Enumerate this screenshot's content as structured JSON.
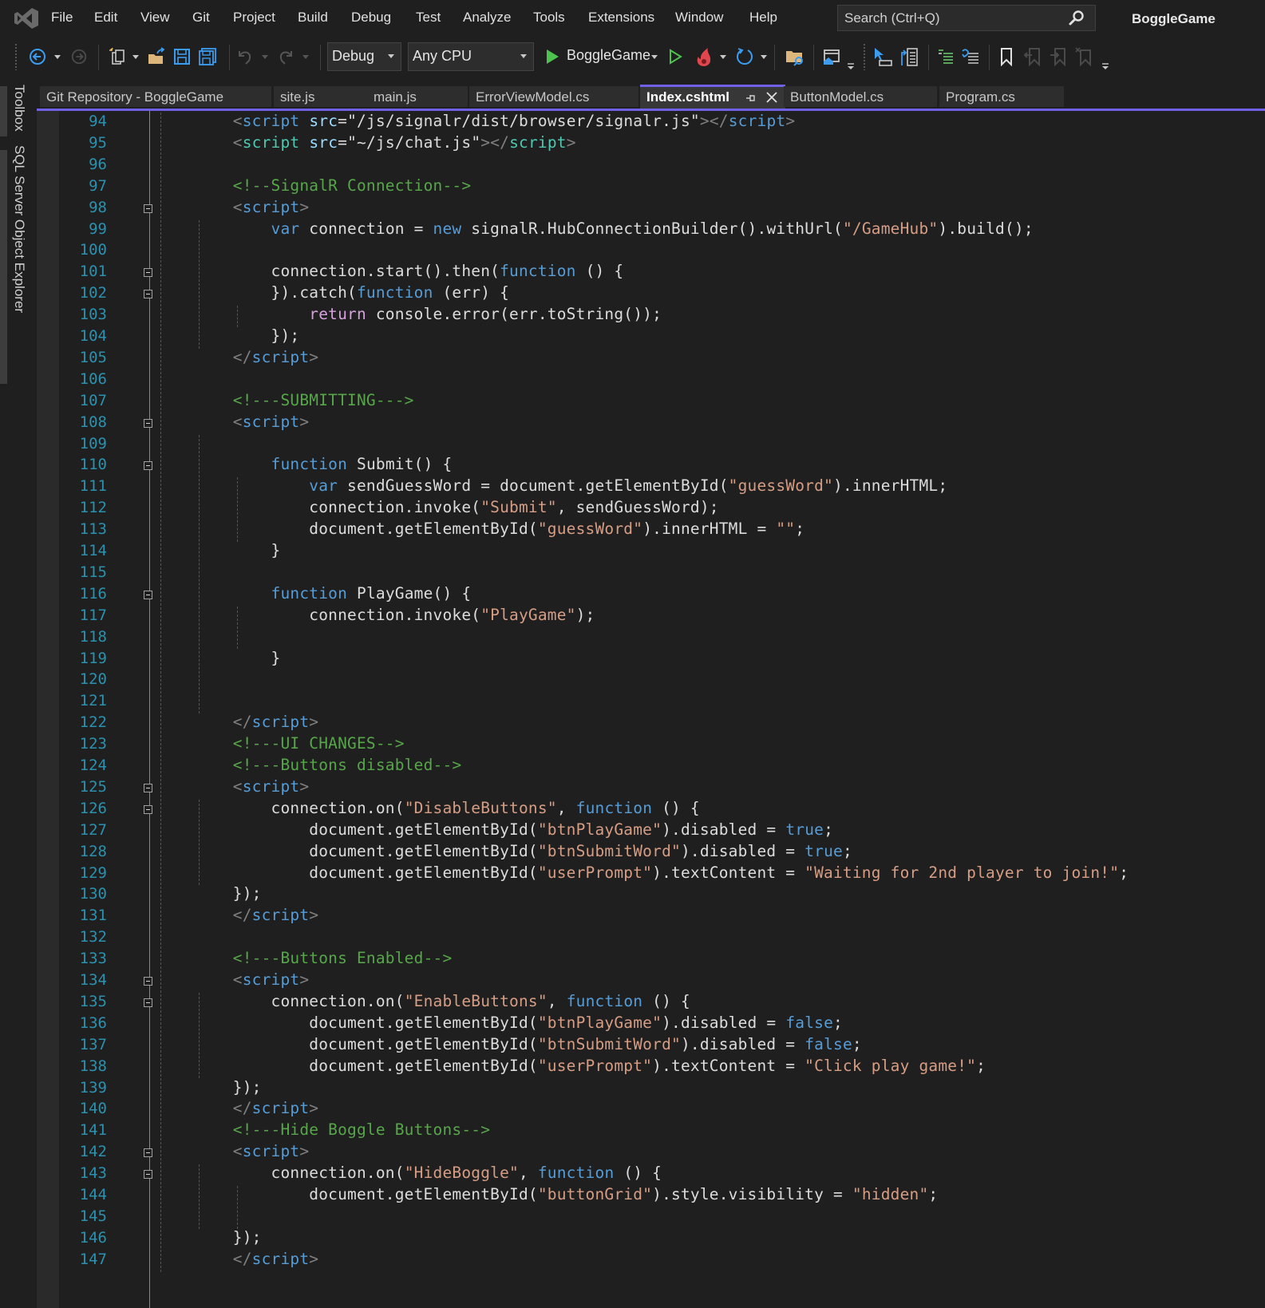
{
  "app": {
    "solution_name": "BoggleGame",
    "accent_color": "#7160e8"
  },
  "menu": {
    "items": [
      "File",
      "Edit",
      "View",
      "Git",
      "Project",
      "Build",
      "Debug",
      "Test",
      "Analyze",
      "Tools",
      "Extensions",
      "Window",
      "Help"
    ],
    "search_placeholder": "Search (Ctrl+Q)"
  },
  "toolbar": {
    "configuration": "Debug",
    "platform": "Any CPU",
    "start_target": "BoggleGame",
    "icons": [
      "back-icon",
      "forward-icon",
      "new-project-icon",
      "open-folder-icon",
      "save-icon",
      "save-all-icon",
      "undo-icon",
      "redo-icon",
      "start-icon",
      "start-without-debugging-icon",
      "hot-reload-icon",
      "restart-icon",
      "solution-explorer-icon",
      "browser-link-icon",
      "select-element-icon",
      "toggle-view-icon",
      "indent-icon",
      "outdent-icon",
      "bookmark-icon",
      "prev-bookmark-icon",
      "next-bookmark-icon",
      "clear-bookmarks-icon",
      "toolbar-options-icon"
    ]
  },
  "side_panels": [
    "Toolbox",
    "SQL Server Object Explorer"
  ],
  "tabs": [
    {
      "label": "Git Repository - BoggleGame",
      "active": false
    },
    {
      "label": "site.js",
      "active": false
    },
    {
      "label": "main.js",
      "active": false
    },
    {
      "label": "ErrorViewModel.cs",
      "active": false
    },
    {
      "label": "Index.cshtml",
      "active": true
    },
    {
      "label": "ButtonModel.cs",
      "active": false
    },
    {
      "label": "Program.cs",
      "active": false
    }
  ],
  "editor": {
    "first_line": 94,
    "lines": [
      {
        "n": "94",
        "fold": false,
        "tokens": [
          [
            "    ",
            "id"
          ],
          [
            "<",
            "pun"
          ],
          [
            "script",
            "tag"
          ],
          [
            " ",
            "id"
          ],
          [
            "src",
            "attr"
          ],
          [
            "=",
            "id"
          ],
          [
            "\"/js/signalr/dist/browser/signalr.js\"",
            "id"
          ],
          [
            "></",
            "pun"
          ],
          [
            "script",
            "tag"
          ],
          [
            ">",
            "pun"
          ]
        ]
      },
      {
        "n": "95",
        "fold": false,
        "tokens": [
          [
            "    ",
            "id"
          ],
          [
            "<",
            "pun"
          ],
          [
            "script",
            "tag2"
          ],
          [
            " ",
            "id"
          ],
          [
            "src",
            "attr"
          ],
          [
            "=",
            "id"
          ],
          [
            "\"~/js/chat.js\"",
            "id"
          ],
          [
            "></",
            "pun"
          ],
          [
            "script",
            "tag2"
          ],
          [
            ">",
            "pun"
          ]
        ]
      },
      {
        "n": "96",
        "fold": false,
        "tokens": []
      },
      {
        "n": "97",
        "fold": false,
        "tokens": [
          [
            "    ",
            "id"
          ],
          [
            "<!--SignalR Connection-->",
            "cmt"
          ]
        ]
      },
      {
        "n": "98",
        "fold": true,
        "tokens": [
          [
            "    ",
            "id"
          ],
          [
            "<",
            "pun"
          ],
          [
            "script",
            "tag"
          ],
          [
            ">",
            "pun"
          ]
        ]
      },
      {
        "n": "99",
        "fold": false,
        "tokens": [
          [
            "        ",
            "id"
          ],
          [
            "var",
            "kw"
          ],
          [
            " connection = ",
            "id"
          ],
          [
            "new",
            "kw"
          ],
          [
            " signalR.HubConnectionBuilder().withUrl(",
            "id"
          ],
          [
            "\"/GameHub\"",
            "str"
          ],
          [
            ").build();",
            "id"
          ]
        ]
      },
      {
        "n": "100",
        "fold": false,
        "tokens": []
      },
      {
        "n": "101",
        "fold": true,
        "tokens": [
          [
            "        connection.start().then(",
            "id"
          ],
          [
            "function",
            "kw"
          ],
          [
            " () {",
            "id"
          ]
        ]
      },
      {
        "n": "102",
        "fold": true,
        "tokens": [
          [
            "        }).catch(",
            "id"
          ],
          [
            "function",
            "kw"
          ],
          [
            " (err) {",
            "id"
          ]
        ]
      },
      {
        "n": "103",
        "fold": false,
        "tokens": [
          [
            "            ",
            "id"
          ],
          [
            "return",
            "ctl"
          ],
          [
            " console.error(err.toString());",
            "id"
          ]
        ]
      },
      {
        "n": "104",
        "fold": false,
        "tokens": [
          [
            "        });",
            "id"
          ]
        ]
      },
      {
        "n": "105",
        "fold": false,
        "tokens": [
          [
            "    ",
            "id"
          ],
          [
            "</",
            "pun"
          ],
          [
            "script",
            "tag"
          ],
          [
            ">",
            "pun"
          ]
        ]
      },
      {
        "n": "106",
        "fold": false,
        "tokens": []
      },
      {
        "n": "107",
        "fold": false,
        "tokens": [
          [
            "    ",
            "id"
          ],
          [
            "<!---SUBMITTING--->",
            "cmt"
          ]
        ]
      },
      {
        "n": "108",
        "fold": true,
        "tokens": [
          [
            "    ",
            "id"
          ],
          [
            "<",
            "pun"
          ],
          [
            "script",
            "tag"
          ],
          [
            ">",
            "pun"
          ]
        ]
      },
      {
        "n": "109",
        "fold": false,
        "tokens": []
      },
      {
        "n": "110",
        "fold": true,
        "tokens": [
          [
            "        ",
            "id"
          ],
          [
            "function",
            "kw"
          ],
          [
            " Submit() {",
            "id"
          ]
        ]
      },
      {
        "n": "111",
        "fold": false,
        "tokens": [
          [
            "            ",
            "id"
          ],
          [
            "var",
            "kw"
          ],
          [
            " sendGuessWord = document.getElementById(",
            "id"
          ],
          [
            "\"guessWord\"",
            "str"
          ],
          [
            ").innerHTML;",
            "id"
          ]
        ]
      },
      {
        "n": "112",
        "fold": false,
        "tokens": [
          [
            "            connection.invoke(",
            "id"
          ],
          [
            "\"Submit\"",
            "str"
          ],
          [
            ", sendGuessWord);",
            "id"
          ]
        ]
      },
      {
        "n": "113",
        "fold": false,
        "tokens": [
          [
            "            document.getElementById(",
            "id"
          ],
          [
            "\"guessWord\"",
            "str"
          ],
          [
            ").innerHTML = ",
            "id"
          ],
          [
            "\"\"",
            "str"
          ],
          [
            ";",
            "id"
          ]
        ]
      },
      {
        "n": "114",
        "fold": false,
        "tokens": [
          [
            "        }",
            "id"
          ]
        ]
      },
      {
        "n": "115",
        "fold": false,
        "tokens": []
      },
      {
        "n": "116",
        "fold": true,
        "tokens": [
          [
            "        ",
            "id"
          ],
          [
            "function",
            "kw"
          ],
          [
            " PlayGame() {",
            "id"
          ]
        ]
      },
      {
        "n": "117",
        "fold": false,
        "tokens": [
          [
            "            connection.invoke(",
            "id"
          ],
          [
            "\"PlayGame\"",
            "str"
          ],
          [
            ");",
            "id"
          ]
        ]
      },
      {
        "n": "118",
        "fold": false,
        "tokens": []
      },
      {
        "n": "119",
        "fold": false,
        "tokens": [
          [
            "        }",
            "id"
          ]
        ]
      },
      {
        "n": "120",
        "fold": false,
        "tokens": []
      },
      {
        "n": "121",
        "fold": false,
        "tokens": []
      },
      {
        "n": "122",
        "fold": false,
        "tokens": [
          [
            "    ",
            "id"
          ],
          [
            "</",
            "pun"
          ],
          [
            "script",
            "tag"
          ],
          [
            ">",
            "pun"
          ]
        ]
      },
      {
        "n": "123",
        "fold": false,
        "tokens": [
          [
            "    ",
            "id"
          ],
          [
            "<!---UI CHANGES-->",
            "cmt"
          ]
        ]
      },
      {
        "n": "124",
        "fold": false,
        "tokens": [
          [
            "    ",
            "id"
          ],
          [
            "<!---Buttons disabled-->",
            "cmt"
          ]
        ]
      },
      {
        "n": "125",
        "fold": true,
        "tokens": [
          [
            "    ",
            "id"
          ],
          [
            "<",
            "pun"
          ],
          [
            "script",
            "tag"
          ],
          [
            ">",
            "pun"
          ]
        ]
      },
      {
        "n": "126",
        "fold": true,
        "tokens": [
          [
            "        connection.on(",
            "id"
          ],
          [
            "\"DisableButtons\"",
            "str"
          ],
          [
            ", ",
            "id"
          ],
          [
            "function",
            "kw"
          ],
          [
            " () {",
            "id"
          ]
        ]
      },
      {
        "n": "127",
        "fold": false,
        "tokens": [
          [
            "            document.getElementById(",
            "id"
          ],
          [
            "\"btnPlayGame\"",
            "str"
          ],
          [
            ").disabled = ",
            "id"
          ],
          [
            "true",
            "kw"
          ],
          [
            ";",
            "id"
          ]
        ]
      },
      {
        "n": "128",
        "fold": false,
        "tokens": [
          [
            "            document.getElementById(",
            "id"
          ],
          [
            "\"btnSubmitWord\"",
            "str"
          ],
          [
            ").disabled = ",
            "id"
          ],
          [
            "true",
            "kw"
          ],
          [
            ";",
            "id"
          ]
        ]
      },
      {
        "n": "129",
        "fold": false,
        "tokens": [
          [
            "            document.getElementById(",
            "id"
          ],
          [
            "\"userPrompt\"",
            "str"
          ],
          [
            ").textContent = ",
            "id"
          ],
          [
            "\"Waiting for 2nd player to join!\"",
            "str"
          ],
          [
            ";",
            "id"
          ]
        ]
      },
      {
        "n": "130",
        "fold": false,
        "tokens": [
          [
            "    });",
            "id"
          ]
        ]
      },
      {
        "n": "131",
        "fold": false,
        "tokens": [
          [
            "    ",
            "id"
          ],
          [
            "</",
            "pun"
          ],
          [
            "script",
            "tag"
          ],
          [
            ">",
            "pun"
          ]
        ]
      },
      {
        "n": "132",
        "fold": false,
        "tokens": []
      },
      {
        "n": "133",
        "fold": false,
        "tokens": [
          [
            "    ",
            "id"
          ],
          [
            "<!---Buttons Enabled-->",
            "cmt"
          ]
        ]
      },
      {
        "n": "134",
        "fold": true,
        "tokens": [
          [
            "    ",
            "id"
          ],
          [
            "<",
            "pun"
          ],
          [
            "script",
            "tag"
          ],
          [
            ">",
            "pun"
          ]
        ]
      },
      {
        "n": "135",
        "fold": true,
        "tokens": [
          [
            "        connection.on(",
            "id"
          ],
          [
            "\"EnableButtons\"",
            "str"
          ],
          [
            ", ",
            "id"
          ],
          [
            "function",
            "kw"
          ],
          [
            " () {",
            "id"
          ]
        ]
      },
      {
        "n": "136",
        "fold": false,
        "tokens": [
          [
            "            document.getElementById(",
            "id"
          ],
          [
            "\"btnPlayGame\"",
            "str"
          ],
          [
            ").disabled = ",
            "id"
          ],
          [
            "false",
            "kw"
          ],
          [
            ";",
            "id"
          ]
        ]
      },
      {
        "n": "137",
        "fold": false,
        "tokens": [
          [
            "            document.getElementById(",
            "id"
          ],
          [
            "\"btnSubmitWord\"",
            "str"
          ],
          [
            ").disabled = ",
            "id"
          ],
          [
            "false",
            "kw"
          ],
          [
            ";",
            "id"
          ]
        ]
      },
      {
        "n": "138",
        "fold": false,
        "tokens": [
          [
            "            document.getElementById(",
            "id"
          ],
          [
            "\"userPrompt\"",
            "str"
          ],
          [
            ").textContent = ",
            "id"
          ],
          [
            "\"Click play game!\"",
            "str"
          ],
          [
            ";",
            "id"
          ]
        ]
      },
      {
        "n": "139",
        "fold": false,
        "tokens": [
          [
            "    });",
            "id"
          ]
        ]
      },
      {
        "n": "140",
        "fold": false,
        "tokens": [
          [
            "    ",
            "id"
          ],
          [
            "</",
            "pun"
          ],
          [
            "script",
            "tag"
          ],
          [
            ">",
            "pun"
          ]
        ]
      },
      {
        "n": "141",
        "fold": false,
        "tokens": [
          [
            "    ",
            "id"
          ],
          [
            "<!---Hide Boggle Buttons-->",
            "cmt"
          ]
        ]
      },
      {
        "n": "142",
        "fold": true,
        "tokens": [
          [
            "    ",
            "id"
          ],
          [
            "<",
            "pun"
          ],
          [
            "script",
            "tag"
          ],
          [
            ">",
            "pun"
          ]
        ]
      },
      {
        "n": "143",
        "fold": true,
        "tokens": [
          [
            "        connection.on(",
            "id"
          ],
          [
            "\"HideBoggle\"",
            "str"
          ],
          [
            ", ",
            "id"
          ],
          [
            "function",
            "kw"
          ],
          [
            " () {",
            "id"
          ]
        ]
      },
      {
        "n": "144",
        "fold": false,
        "tokens": [
          [
            "            document.getElementById(",
            "id"
          ],
          [
            "\"buttonGrid\"",
            "str"
          ],
          [
            ").style.visibility = ",
            "id"
          ],
          [
            "\"hidden\"",
            "str"
          ],
          [
            ";",
            "id"
          ]
        ]
      },
      {
        "n": "145",
        "fold": false,
        "tokens": []
      },
      {
        "n": "146",
        "fold": false,
        "tokens": [
          [
            "    });",
            "id"
          ]
        ]
      },
      {
        "n": "147",
        "fold": false,
        "tokens": [
          [
            "    ",
            "id"
          ],
          [
            "</",
            "pun"
          ],
          [
            "script",
            "tag"
          ],
          [
            ">",
            "pun"
          ]
        ]
      }
    ]
  }
}
